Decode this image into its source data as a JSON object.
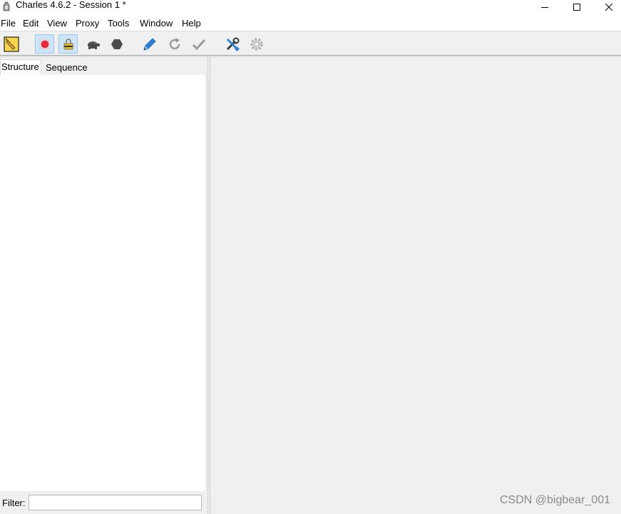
{
  "window": {
    "title": "Charles 4.6.2 - Session 1 *"
  },
  "menu": [
    {
      "label": "File",
      "name": "menu-file"
    },
    {
      "label": "Edit",
      "name": "menu-edit"
    },
    {
      "label": "View",
      "name": "menu-view"
    },
    {
      "label": "Proxy",
      "name": "menu-proxy"
    },
    {
      "label": "Tools",
      "name": "menu-tools"
    },
    {
      "label": "Window",
      "name": "menu-window"
    },
    {
      "label": "Help",
      "name": "menu-help"
    }
  ],
  "toolbar": [
    {
      "name": "clear-session-button",
      "icon": "broom-icon"
    },
    {
      "name": "record-button",
      "icon": "record-icon",
      "active": true
    },
    {
      "name": "ssl-proxying-button",
      "icon": "lock-icon",
      "active": true
    },
    {
      "name": "throttle-button",
      "icon": "turtle-icon"
    },
    {
      "name": "breakpoints-button",
      "icon": "stop-hexagon-icon"
    },
    {
      "name": "compose-button",
      "icon": "pen-icon"
    },
    {
      "name": "repeat-button",
      "icon": "refresh-icon"
    },
    {
      "name": "validate-button",
      "icon": "checkmark-icon"
    },
    {
      "name": "tools-button",
      "icon": "wrench-screwdriver-icon"
    },
    {
      "name": "settings-button",
      "icon": "gear-icon"
    }
  ],
  "tabs": {
    "structure": "Structure",
    "sequence": "Sequence"
  },
  "filter": {
    "label": "Filter:",
    "value": ""
  },
  "watermark": "CSDN @bigbear_001",
  "colors": {
    "record": "#e8283c",
    "pen": "#2f7fd6",
    "active_bg": "#cfe4f7"
  }
}
